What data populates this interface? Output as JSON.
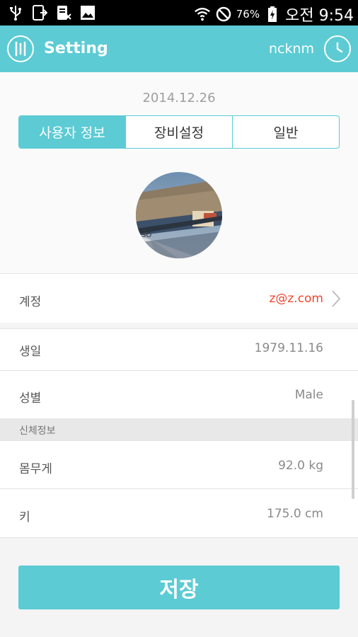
{
  "status_bar": {
    "battery_percent": "76%",
    "time": "오전 9:54",
    "left_icons": [
      "usb-icon",
      "screen-mirror-icon",
      "notification-icon",
      "image-icon"
    ],
    "right_icons": [
      "wifi-icon",
      "do-not-disturb-icon",
      "battery-icon"
    ]
  },
  "app_bar": {
    "title": "Setting",
    "nickname": "ncknm",
    "accent_color": "#5ccbd4"
  },
  "date": "2014.12.26",
  "tabs": [
    {
      "label": "사용자 정보",
      "active": true
    },
    {
      "label": "장비설정",
      "active": false
    },
    {
      "label": "일반",
      "active": false
    }
  ],
  "account": {
    "label": "계정",
    "value": "z@z.com"
  },
  "profile": [
    {
      "label": "생일",
      "value": "1979.11.16"
    },
    {
      "label": "성별",
      "value": "Male"
    }
  ],
  "body_section": {
    "title": "신체정보",
    "rows": [
      {
        "label": "몸무게",
        "value": "92.0 kg"
      },
      {
        "label": "키",
        "value": "175.0 cm"
      }
    ]
  },
  "save_label": "저장"
}
